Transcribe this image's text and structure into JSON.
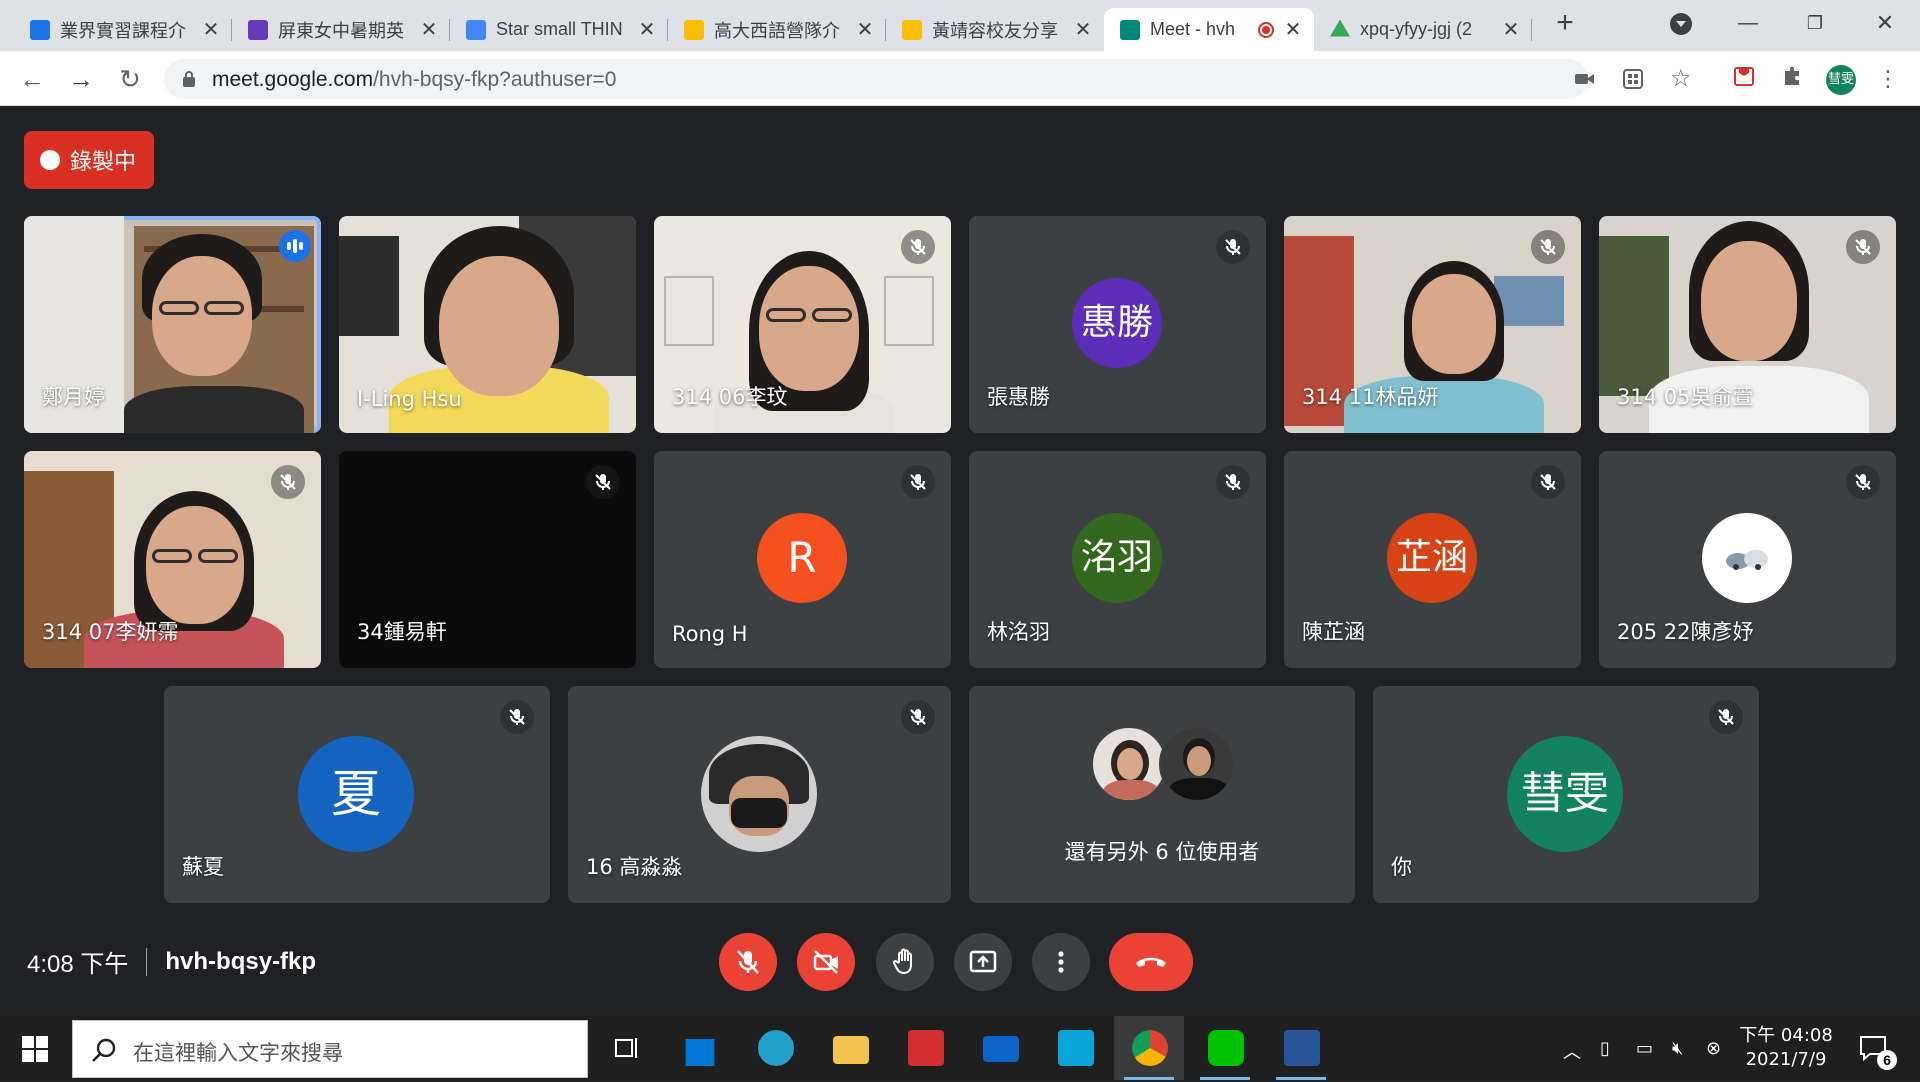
{
  "browser": {
    "tabs": [
      {
        "title": "業界實習課程介",
        "favicon": "#1a73e8"
      },
      {
        "title": "屏東女中暑期英",
        "favicon": "#673ab7"
      },
      {
        "title": "Star small THIN",
        "favicon": "#4285f4"
      },
      {
        "title": "高大西語營隊介",
        "favicon": "#fbbc04"
      },
      {
        "title": "黃靖容校友分享",
        "favicon": "#fbbc04"
      },
      {
        "title": "Meet - hvh",
        "favicon": "#00897b"
      },
      {
        "title": "xpq-yfyy-jgj (2",
        "favicon": "#34a853"
      }
    ],
    "url_host": "meet.google.com",
    "url_path": "/hvh-bqsy-fkp?authuser=0",
    "profile_initials": "彗雯",
    "profile_color": "#12825f"
  },
  "meet": {
    "recording_label": "錄製中",
    "time": "4:08 下午",
    "meeting_code": "hvh-bqsy-fkp",
    "participant_count": "21",
    "tiles": [
      {
        "name": "鄭月婷",
        "type": "video",
        "speaking": true
      },
      {
        "name": "I-Ling Hsu",
        "type": "video",
        "speaking": false
      },
      {
        "name": "314 06李玟",
        "type": "video",
        "muted": true
      },
      {
        "name": "張惠勝",
        "type": "avatar",
        "avatar_text": "惠勝",
        "avatar_color": "#5b2db8",
        "muted": true
      },
      {
        "name": "314 11林品妍",
        "type": "video",
        "muted": true
      },
      {
        "name": "314 05吳俞萱",
        "type": "video",
        "muted": true
      },
      {
        "name": "314 07李妍霈",
        "type": "video",
        "muted": true
      },
      {
        "name": "34鍾易軒",
        "type": "dark",
        "muted": true
      },
      {
        "name": "Rong H",
        "type": "avatar",
        "avatar_text": "R",
        "avatar_color": "#f4511e",
        "muted": true
      },
      {
        "name": "林洺羽",
        "type": "avatar",
        "avatar_text": "洺羽",
        "avatar_color": "#33691e",
        "muted": true
      },
      {
        "name": "陳芷涵",
        "type": "avatar",
        "avatar_text": "芷涵",
        "avatar_color": "#d84315",
        "muted": true
      },
      {
        "name": "205 22陳彥妤",
        "type": "avatar-image",
        "avatar_color": "#ffffff",
        "muted": true
      },
      {
        "name": "蘇夏",
        "type": "avatar",
        "avatar_text": "夏",
        "avatar_color": "#1565c0",
        "muted": true
      },
      {
        "name": "16 高淼淼",
        "type": "avatar-image",
        "avatar_color": "#d0d0d0",
        "muted": true
      },
      {
        "name": "還有另外 6 位使用者",
        "type": "others"
      },
      {
        "name": "你",
        "type": "avatar",
        "avatar_text": "彗雯",
        "avatar_color": "#12825f",
        "muted": true
      }
    ]
  },
  "taskbar": {
    "search_placeholder": "在這裡輸入文字來搜尋",
    "clock_time": "下午 04:08",
    "clock_date": "2021/7/9",
    "notification_count": "6"
  }
}
